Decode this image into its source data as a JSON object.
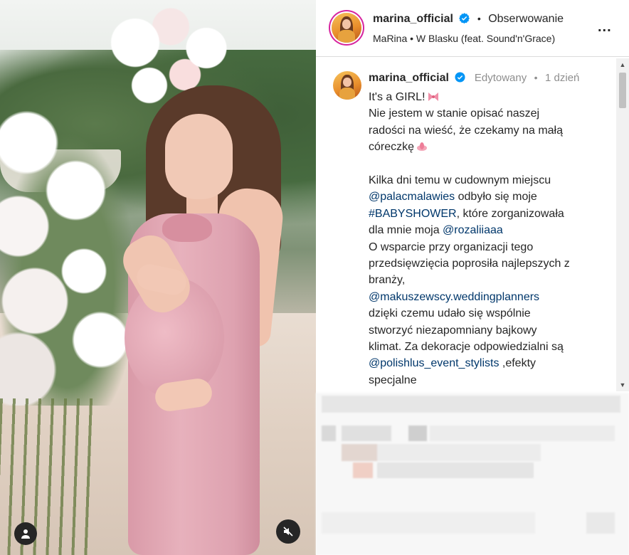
{
  "header": {
    "username": "marina_official",
    "verified": true,
    "follow_label": "Obserwowanie",
    "separator": "•",
    "song_line": "MaRina • W Blasku (feat. Sound'n'Grace)",
    "more_label": "..."
  },
  "post": {
    "username": "marina_official",
    "edited_label": "Edytowany",
    "separator": "•",
    "time": "1 dzień",
    "caption": {
      "l1": "It's a GIRL!",
      "l2": "Nie jestem w stanie opisać naszej",
      "l3": "radości na wieść, że czekamy na małą",
      "l4": "córeczkę",
      "l5": "Kilka dni temu w cudownym miejscu",
      "l6_link": "@palacmalawies",
      "l6_text": " odbyło się moje",
      "l7_link": "#BABYSHOWER",
      "l7_text": ", które zorganizowała",
      "l8_text": "dla mnie moja ",
      "l8_link": "@rozaliiaaa",
      "l9": "O wsparcie przy organizacji tego",
      "l10": "przedsięwzięcia poprosiła najlepszych z",
      "l11": "branży,",
      "l12_link": "@makuszewscy.weddingplanners",
      "l13": "dzięki czemu udało się wspólnie",
      "l14": "stworzyć niezapomniany bajkowy",
      "l15": "klimat. Za dekoracje odpowiedzialni są",
      "l16_link": "@polishlus_event_stylists",
      "l16_text": " ,efekty",
      "l17": "specjalne"
    }
  },
  "media": {
    "user_tag_icon": "person-icon",
    "mute_icon": "sound-off-icon"
  },
  "colors": {
    "link": "#00376b",
    "verified_badge": "#0095f6",
    "text": "#262626",
    "muted": "#8e8e8e"
  }
}
